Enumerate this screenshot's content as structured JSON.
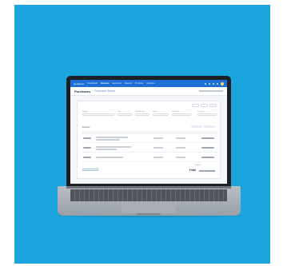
{
  "screen": {
    "brand": "Quaderno",
    "nav": [
      {
        "label": "Dashboard",
        "active": false
      },
      {
        "label": "Invoices",
        "active": true
      },
      {
        "label": "Expenses",
        "active": false
      },
      {
        "label": "Reports",
        "active": false
      },
      {
        "label": "Products",
        "active": false
      },
      {
        "label": "Contacts",
        "active": false
      }
    ],
    "page_title": "Purchases",
    "breadcrumb_sep": "›",
    "breadcrumb": "Purchase Orders",
    "fields": [
      {
        "label": "Supplier"
      },
      {
        "label": "Date"
      },
      {
        "label": "Delivery date"
      },
      {
        "label": "Ship to"
      },
      {
        "label": "Reference"
      },
      {
        "label": "Currency"
      }
    ],
    "section_label": "Products",
    "total_label": "Subtotal",
    "total_value": "Total"
  },
  "colors": {
    "backdrop": "#1aa6dc",
    "topbar": "#1d6fd6"
  }
}
